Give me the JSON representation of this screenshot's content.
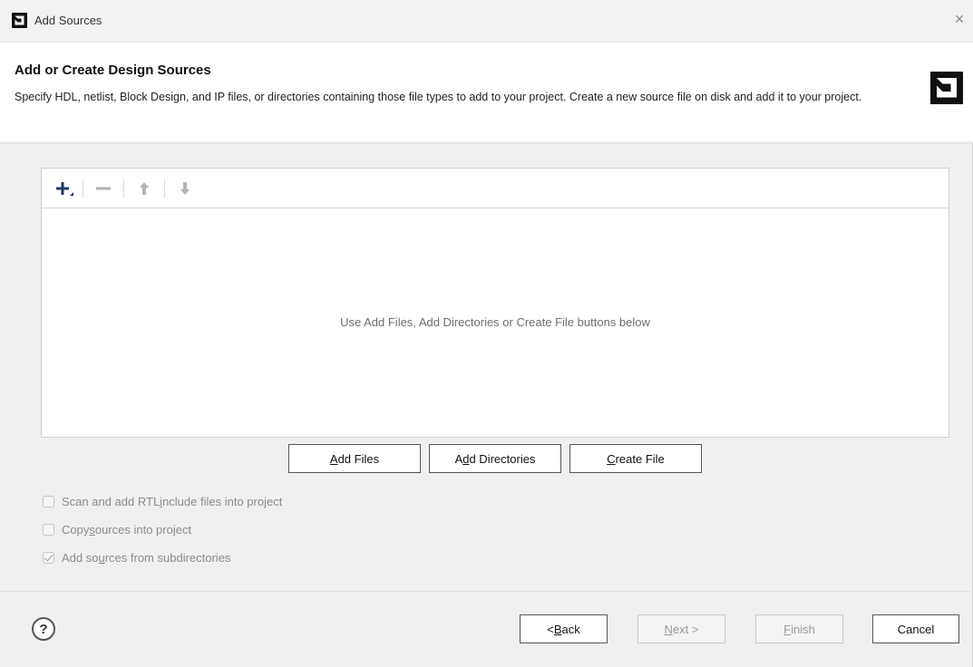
{
  "window": {
    "title": "Add Sources",
    "close_glyph": "×"
  },
  "header": {
    "title": "Add or Create Design Sources",
    "description": "Specify HDL, netlist, Block Design, and IP files, or directories containing those file types to add to your project. Create a new source file on disk and add it to your project."
  },
  "toolbar": {
    "icons": [
      "plus-icon",
      "minus-icon",
      "arrow-up-icon",
      "arrow-down-icon"
    ]
  },
  "file_list": {
    "empty_hint": "Use Add Files, Add Directories or Create File buttons below"
  },
  "actions": {
    "add_files": {
      "pre": "",
      "u": "A",
      "post": "dd Files"
    },
    "add_directories": {
      "pre": "A",
      "u": "d",
      "post": "d Directories"
    },
    "create_file": {
      "pre": "",
      "u": "C",
      "post": "reate File"
    }
  },
  "options": [
    {
      "pre": "Scan and add RTL ",
      "u": "i",
      "post": "nclude files into project",
      "checked": false
    },
    {
      "pre": "Copy ",
      "u": "s",
      "post": "ources into project",
      "checked": false
    },
    {
      "pre": "Add so",
      "u": "u",
      "post": "rces from subdirectories",
      "checked": true
    }
  ],
  "footer": {
    "help": "?",
    "back": {
      "pre": "< ",
      "u": "B",
      "post": "ack"
    },
    "next": {
      "pre": "",
      "u": "N",
      "post": "ext >"
    },
    "finish": {
      "pre": "",
      "u": "F",
      "post": "inish"
    },
    "cancel": "Cancel"
  },
  "colors": {
    "brand": "#111111",
    "window_bg": "#f0f0f0",
    "disabled_text": "#9a9a9a"
  }
}
